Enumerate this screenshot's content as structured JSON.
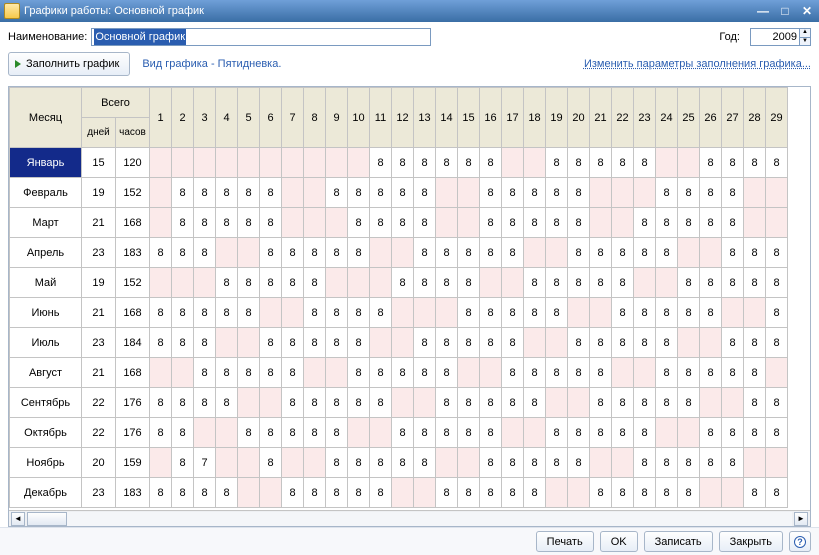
{
  "window": {
    "title": "Графики работы: Основной график"
  },
  "labels": {
    "name": "Наименование:",
    "year": "Год:",
    "fill_button": "Заполнить график",
    "schedule_type": "Вид графика - Пятидневка.",
    "change_params": "Изменить параметры заполнения графика...",
    "month": "Месяц",
    "total": "Всего",
    "days": "дней",
    "hours": "часов"
  },
  "form": {
    "name_value": "Основной график",
    "year_value": "2009"
  },
  "footer": {
    "print": "Печать",
    "ok": "OK",
    "save": "Записать",
    "close": "Закрыть"
  },
  "day_numbers": [
    1,
    2,
    3,
    4,
    5,
    6,
    7,
    8,
    9,
    10,
    11,
    12,
    13,
    14,
    15,
    16,
    17,
    18,
    19,
    20,
    21,
    22,
    23,
    24,
    25,
    26,
    27,
    28,
    29
  ],
  "months": [
    {
      "name": "Январь",
      "days": 15,
      "hours": 120,
      "cells": [
        {
          "v": "",
          "off": true
        },
        {
          "v": "",
          "off": true
        },
        {
          "v": "",
          "off": true
        },
        {
          "v": "",
          "off": true
        },
        {
          "v": "",
          "off": true
        },
        {
          "v": "",
          "off": true
        },
        {
          "v": "",
          "off": true
        },
        {
          "v": "",
          "off": true
        },
        {
          "v": "",
          "off": true
        },
        {
          "v": "",
          "off": true
        },
        {
          "v": "8"
        },
        {
          "v": "8"
        },
        {
          "v": "8"
        },
        {
          "v": "8"
        },
        {
          "v": "8"
        },
        {
          "v": "8"
        },
        {
          "v": "",
          "off": true
        },
        {
          "v": "",
          "off": true
        },
        {
          "v": "8"
        },
        {
          "v": "8"
        },
        {
          "v": "8"
        },
        {
          "v": "8"
        },
        {
          "v": "8"
        },
        {
          "v": "",
          "off": true
        },
        {
          "v": "",
          "off": true
        },
        {
          "v": "8"
        },
        {
          "v": "8"
        },
        {
          "v": "8"
        },
        {
          "v": "8"
        }
      ]
    },
    {
      "name": "Февраль",
      "days": 19,
      "hours": 152,
      "cells": [
        {
          "v": "",
          "off": true
        },
        {
          "v": "8"
        },
        {
          "v": "8"
        },
        {
          "v": "8"
        },
        {
          "v": "8"
        },
        {
          "v": "8"
        },
        {
          "v": "",
          "off": true
        },
        {
          "v": "",
          "off": true
        },
        {
          "v": "8"
        },
        {
          "v": "8"
        },
        {
          "v": "8"
        },
        {
          "v": "8"
        },
        {
          "v": "8"
        },
        {
          "v": "",
          "off": true
        },
        {
          "v": "",
          "off": true
        },
        {
          "v": "8"
        },
        {
          "v": "8"
        },
        {
          "v": "8"
        },
        {
          "v": "8"
        },
        {
          "v": "8"
        },
        {
          "v": "",
          "off": true
        },
        {
          "v": "",
          "off": true
        },
        {
          "v": "",
          "off": true
        },
        {
          "v": "8"
        },
        {
          "v": "8"
        },
        {
          "v": "8"
        },
        {
          "v": "8"
        },
        {
          "v": "",
          "off": true
        },
        {
          "v": "",
          "off": true
        }
      ]
    },
    {
      "name": "Март",
      "days": 21,
      "hours": 168,
      "cells": [
        {
          "v": "",
          "off": true
        },
        {
          "v": "8"
        },
        {
          "v": "8"
        },
        {
          "v": "8"
        },
        {
          "v": "8"
        },
        {
          "v": "8"
        },
        {
          "v": "",
          "off": true
        },
        {
          "v": "",
          "off": true
        },
        {
          "v": "",
          "off": true
        },
        {
          "v": "8"
        },
        {
          "v": "8"
        },
        {
          "v": "8"
        },
        {
          "v": "8"
        },
        {
          "v": "",
          "off": true
        },
        {
          "v": "",
          "off": true
        },
        {
          "v": "8"
        },
        {
          "v": "8"
        },
        {
          "v": "8"
        },
        {
          "v": "8"
        },
        {
          "v": "8"
        },
        {
          "v": "",
          "off": true
        },
        {
          "v": "",
          "off": true
        },
        {
          "v": "8"
        },
        {
          "v": "8"
        },
        {
          "v": "8"
        },
        {
          "v": "8"
        },
        {
          "v": "8"
        },
        {
          "v": "",
          "off": true
        },
        {
          "v": "",
          "off": true
        }
      ]
    },
    {
      "name": "Апрель",
      "days": 23,
      "hours": 183,
      "cells": [
        {
          "v": "8"
        },
        {
          "v": "8"
        },
        {
          "v": "8"
        },
        {
          "v": "",
          "off": true
        },
        {
          "v": "",
          "off": true
        },
        {
          "v": "8"
        },
        {
          "v": "8"
        },
        {
          "v": "8"
        },
        {
          "v": "8"
        },
        {
          "v": "8"
        },
        {
          "v": "",
          "off": true
        },
        {
          "v": "",
          "off": true
        },
        {
          "v": "8"
        },
        {
          "v": "8"
        },
        {
          "v": "8"
        },
        {
          "v": "8"
        },
        {
          "v": "8"
        },
        {
          "v": "",
          "off": true
        },
        {
          "v": "",
          "off": true
        },
        {
          "v": "8"
        },
        {
          "v": "8"
        },
        {
          "v": "8"
        },
        {
          "v": "8"
        },
        {
          "v": "8"
        },
        {
          "v": "",
          "off": true
        },
        {
          "v": "",
          "off": true
        },
        {
          "v": "8"
        },
        {
          "v": "8"
        },
        {
          "v": "8"
        }
      ]
    },
    {
      "name": "Май",
      "days": 19,
      "hours": 152,
      "cells": [
        {
          "v": "",
          "off": true
        },
        {
          "v": "",
          "off": true
        },
        {
          "v": "",
          "off": true
        },
        {
          "v": "8"
        },
        {
          "v": "8"
        },
        {
          "v": "8"
        },
        {
          "v": "8"
        },
        {
          "v": "8"
        },
        {
          "v": "",
          "off": true
        },
        {
          "v": "",
          "off": true
        },
        {
          "v": "",
          "off": true
        },
        {
          "v": "8"
        },
        {
          "v": "8"
        },
        {
          "v": "8"
        },
        {
          "v": "8"
        },
        {
          "v": "",
          "off": true
        },
        {
          "v": "",
          "off": true
        },
        {
          "v": "8"
        },
        {
          "v": "8"
        },
        {
          "v": "8"
        },
        {
          "v": "8"
        },
        {
          "v": "8"
        },
        {
          "v": "",
          "off": true
        },
        {
          "v": "",
          "off": true
        },
        {
          "v": "8"
        },
        {
          "v": "8"
        },
        {
          "v": "8"
        },
        {
          "v": "8"
        },
        {
          "v": "8"
        }
      ]
    },
    {
      "name": "Июнь",
      "days": 21,
      "hours": 168,
      "cells": [
        {
          "v": "8"
        },
        {
          "v": "8"
        },
        {
          "v": "8"
        },
        {
          "v": "8"
        },
        {
          "v": "8"
        },
        {
          "v": "",
          "off": true
        },
        {
          "v": "",
          "off": true
        },
        {
          "v": "8"
        },
        {
          "v": "8"
        },
        {
          "v": "8"
        },
        {
          "v": "8"
        },
        {
          "v": "",
          "off": true
        },
        {
          "v": "",
          "off": true
        },
        {
          "v": "",
          "off": true
        },
        {
          "v": "8"
        },
        {
          "v": "8"
        },
        {
          "v": "8"
        },
        {
          "v": "8"
        },
        {
          "v": "8"
        },
        {
          "v": "",
          "off": true
        },
        {
          "v": "",
          "off": true
        },
        {
          "v": "8"
        },
        {
          "v": "8"
        },
        {
          "v": "8"
        },
        {
          "v": "8"
        },
        {
          "v": "8"
        },
        {
          "v": "",
          "off": true
        },
        {
          "v": "",
          "off": true
        },
        {
          "v": "8"
        }
      ]
    },
    {
      "name": "Июль",
      "days": 23,
      "hours": 184,
      "cells": [
        {
          "v": "8"
        },
        {
          "v": "8"
        },
        {
          "v": "8"
        },
        {
          "v": "",
          "off": true
        },
        {
          "v": "",
          "off": true
        },
        {
          "v": "8"
        },
        {
          "v": "8"
        },
        {
          "v": "8"
        },
        {
          "v": "8"
        },
        {
          "v": "8"
        },
        {
          "v": "",
          "off": true
        },
        {
          "v": "",
          "off": true
        },
        {
          "v": "8"
        },
        {
          "v": "8"
        },
        {
          "v": "8"
        },
        {
          "v": "8"
        },
        {
          "v": "8"
        },
        {
          "v": "",
          "off": true
        },
        {
          "v": "",
          "off": true
        },
        {
          "v": "8"
        },
        {
          "v": "8"
        },
        {
          "v": "8"
        },
        {
          "v": "8"
        },
        {
          "v": "8"
        },
        {
          "v": "",
          "off": true
        },
        {
          "v": "",
          "off": true
        },
        {
          "v": "8"
        },
        {
          "v": "8"
        },
        {
          "v": "8"
        }
      ]
    },
    {
      "name": "Август",
      "days": 21,
      "hours": 168,
      "cells": [
        {
          "v": "",
          "off": true
        },
        {
          "v": "",
          "off": true
        },
        {
          "v": "8"
        },
        {
          "v": "8"
        },
        {
          "v": "8"
        },
        {
          "v": "8"
        },
        {
          "v": "8"
        },
        {
          "v": "",
          "off": true
        },
        {
          "v": "",
          "off": true
        },
        {
          "v": "8"
        },
        {
          "v": "8"
        },
        {
          "v": "8"
        },
        {
          "v": "8"
        },
        {
          "v": "8"
        },
        {
          "v": "",
          "off": true
        },
        {
          "v": "",
          "off": true
        },
        {
          "v": "8"
        },
        {
          "v": "8"
        },
        {
          "v": "8"
        },
        {
          "v": "8"
        },
        {
          "v": "8"
        },
        {
          "v": "",
          "off": true
        },
        {
          "v": "",
          "off": true
        },
        {
          "v": "8"
        },
        {
          "v": "8"
        },
        {
          "v": "8"
        },
        {
          "v": "8"
        },
        {
          "v": "8"
        },
        {
          "v": "",
          "off": true
        }
      ]
    },
    {
      "name": "Сентябрь",
      "days": 22,
      "hours": 176,
      "cells": [
        {
          "v": "8"
        },
        {
          "v": "8"
        },
        {
          "v": "8"
        },
        {
          "v": "8"
        },
        {
          "v": "",
          "off": true
        },
        {
          "v": "",
          "off": true
        },
        {
          "v": "8"
        },
        {
          "v": "8"
        },
        {
          "v": "8"
        },
        {
          "v": "8"
        },
        {
          "v": "8"
        },
        {
          "v": "",
          "off": true
        },
        {
          "v": "",
          "off": true
        },
        {
          "v": "8"
        },
        {
          "v": "8"
        },
        {
          "v": "8"
        },
        {
          "v": "8"
        },
        {
          "v": "8"
        },
        {
          "v": "",
          "off": true
        },
        {
          "v": "",
          "off": true
        },
        {
          "v": "8"
        },
        {
          "v": "8"
        },
        {
          "v": "8"
        },
        {
          "v": "8"
        },
        {
          "v": "8"
        },
        {
          "v": "",
          "off": true
        },
        {
          "v": "",
          "off": true
        },
        {
          "v": "8"
        },
        {
          "v": "8"
        }
      ]
    },
    {
      "name": "Октябрь",
      "days": 22,
      "hours": 176,
      "cells": [
        {
          "v": "8"
        },
        {
          "v": "8"
        },
        {
          "v": "",
          "off": true
        },
        {
          "v": "",
          "off": true
        },
        {
          "v": "8"
        },
        {
          "v": "8"
        },
        {
          "v": "8"
        },
        {
          "v": "8"
        },
        {
          "v": "8"
        },
        {
          "v": "",
          "off": true
        },
        {
          "v": "",
          "off": true
        },
        {
          "v": "8"
        },
        {
          "v": "8"
        },
        {
          "v": "8"
        },
        {
          "v": "8"
        },
        {
          "v": "8"
        },
        {
          "v": "",
          "off": true
        },
        {
          "v": "",
          "off": true
        },
        {
          "v": "8"
        },
        {
          "v": "8"
        },
        {
          "v": "8"
        },
        {
          "v": "8"
        },
        {
          "v": "8"
        },
        {
          "v": "",
          "off": true
        },
        {
          "v": "",
          "off": true
        },
        {
          "v": "8"
        },
        {
          "v": "8"
        },
        {
          "v": "8"
        },
        {
          "v": "8"
        }
      ]
    },
    {
      "name": "Ноябрь",
      "days": 20,
      "hours": 159,
      "cells": [
        {
          "v": "",
          "off": true
        },
        {
          "v": "8"
        },
        {
          "v": "7"
        },
        {
          "v": "",
          "off": true
        },
        {
          "v": "",
          "off": true
        },
        {
          "v": "8"
        },
        {
          "v": "",
          "off": true
        },
        {
          "v": "",
          "off": true
        },
        {
          "v": "8"
        },
        {
          "v": "8"
        },
        {
          "v": "8"
        },
        {
          "v": "8"
        },
        {
          "v": "8"
        },
        {
          "v": "",
          "off": true
        },
        {
          "v": "",
          "off": true
        },
        {
          "v": "8"
        },
        {
          "v": "8"
        },
        {
          "v": "8"
        },
        {
          "v": "8"
        },
        {
          "v": "8"
        },
        {
          "v": "",
          "off": true
        },
        {
          "v": "",
          "off": true
        },
        {
          "v": "8"
        },
        {
          "v": "8"
        },
        {
          "v": "8"
        },
        {
          "v": "8"
        },
        {
          "v": "8"
        },
        {
          "v": "",
          "off": true
        },
        {
          "v": "",
          "off": true
        }
      ]
    },
    {
      "name": "Декабрь",
      "days": 23,
      "hours": 183,
      "cells": [
        {
          "v": "8"
        },
        {
          "v": "8"
        },
        {
          "v": "8"
        },
        {
          "v": "8"
        },
        {
          "v": "",
          "off": true
        },
        {
          "v": "",
          "off": true
        },
        {
          "v": "8"
        },
        {
          "v": "8"
        },
        {
          "v": "8"
        },
        {
          "v": "8"
        },
        {
          "v": "8"
        },
        {
          "v": "",
          "off": true
        },
        {
          "v": "",
          "off": true
        },
        {
          "v": "8"
        },
        {
          "v": "8"
        },
        {
          "v": "8"
        },
        {
          "v": "8"
        },
        {
          "v": "8"
        },
        {
          "v": "",
          "off": true
        },
        {
          "v": "",
          "off": true
        },
        {
          "v": "8"
        },
        {
          "v": "8"
        },
        {
          "v": "8"
        },
        {
          "v": "8"
        },
        {
          "v": "8"
        },
        {
          "v": "",
          "off": true
        },
        {
          "v": "",
          "off": true
        },
        {
          "v": "8"
        },
        {
          "v": "8"
        }
      ]
    }
  ]
}
